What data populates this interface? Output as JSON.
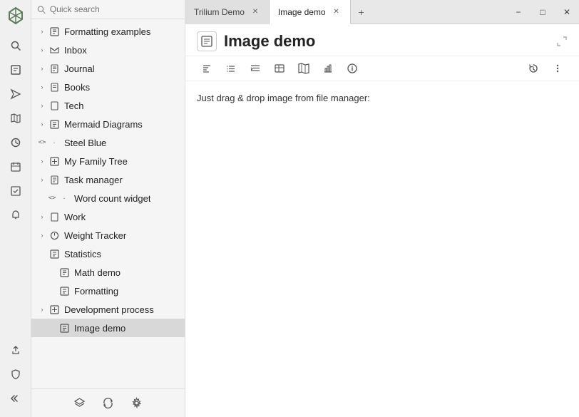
{
  "app": {
    "logo_icon": "❧",
    "search_placeholder": "Quick search"
  },
  "tabs": [
    {
      "id": "trilium-demo",
      "label": "Trilium Demo",
      "active": false,
      "closable": true
    },
    {
      "id": "image-demo",
      "label": "Image demo",
      "active": true,
      "closable": true
    }
  ],
  "tab_add_label": "+",
  "window_controls": [
    "−",
    "□",
    "✕"
  ],
  "note": {
    "icon": "▣",
    "title": "Image demo",
    "content": "Just drag & drop image from file manager:"
  },
  "toolbar_buttons": [
    "⚌",
    "≡",
    "≡+",
    "⊞",
    "⊞",
    "ıll",
    "ⓘ"
  ],
  "toolbar_right": [
    "⟲",
    "⋮"
  ],
  "sidebar": {
    "search_placeholder": "Quick search",
    "items": [
      {
        "id": "formatting-examples",
        "label": "Formatting examples",
        "level": 0,
        "chevron": "›",
        "icon": "▣",
        "has_children": true
      },
      {
        "id": "inbox",
        "label": "Inbox",
        "level": 0,
        "chevron": "›",
        "icon": "📁",
        "has_children": true
      },
      {
        "id": "journal",
        "label": "Journal",
        "level": 0,
        "chevron": "›",
        "icon": "📁",
        "has_children": true
      },
      {
        "id": "books",
        "label": "Books",
        "level": 0,
        "chevron": "›",
        "icon": "📁",
        "has_children": true
      },
      {
        "id": "tech",
        "label": "Tech",
        "level": 0,
        "chevron": "›",
        "icon": "📁",
        "has_children": true
      },
      {
        "id": "mermaid-diagrams",
        "label": "Mermaid Diagrams",
        "level": 0,
        "chevron": "›",
        "icon": "▣",
        "has_children": true
      },
      {
        "id": "steel-blue",
        "label": "Steel Blue",
        "level": 0,
        "chevron": "‹›",
        "icon": "·",
        "has_children": true,
        "code": true
      },
      {
        "id": "my-family-tree",
        "label": "My Family Tree",
        "level": 0,
        "chevron": "›",
        "icon": "⊞",
        "has_children": true
      },
      {
        "id": "task-manager",
        "label": "Task manager",
        "level": 0,
        "chevron": "›",
        "icon": "📁",
        "has_children": true
      },
      {
        "id": "word-count-widget",
        "label": "Word count widget",
        "level": 1,
        "chevron": "‹›",
        "icon": "·",
        "has_children": false,
        "code": true
      },
      {
        "id": "work",
        "label": "Work",
        "level": 0,
        "chevron": "›",
        "icon": "📁",
        "has_children": true
      },
      {
        "id": "weight-tracker",
        "label": "Weight Tracker",
        "level": 0,
        "chevron": "›",
        "icon": "⊙",
        "has_children": true
      },
      {
        "id": "statistics",
        "label": "Statistics",
        "level": 0,
        "chevron": "›",
        "icon": "▣",
        "has_children": false
      },
      {
        "id": "math-demo",
        "label": "Math demo",
        "level": 1,
        "chevron": "",
        "icon": "▣",
        "has_children": false
      },
      {
        "id": "formatting",
        "label": "Formatting",
        "level": 1,
        "chevron": "",
        "icon": "▣",
        "has_children": false
      },
      {
        "id": "development-process",
        "label": "Development process",
        "level": 0,
        "chevron": "›",
        "icon": "⊞",
        "has_children": true
      },
      {
        "id": "image-demo",
        "label": "Image demo",
        "level": 1,
        "chevron": "",
        "icon": "▣",
        "has_children": false,
        "selected": true
      }
    ],
    "footer_icons": [
      "⊕",
      "↺",
      "⚙"
    ]
  },
  "rail_icons": [
    "🔍",
    "📋",
    "📤",
    "🗺",
    "⏰",
    "📅",
    "📋",
    "🔔",
    "📤"
  ],
  "colors": {
    "sidebar_bg": "#f5f5f5",
    "selected_bg": "#d8d8d8",
    "rail_bg": "#f0f0f0",
    "tab_active_bg": "#ffffff",
    "tab_inactive_bg": "#e0e0e0"
  }
}
